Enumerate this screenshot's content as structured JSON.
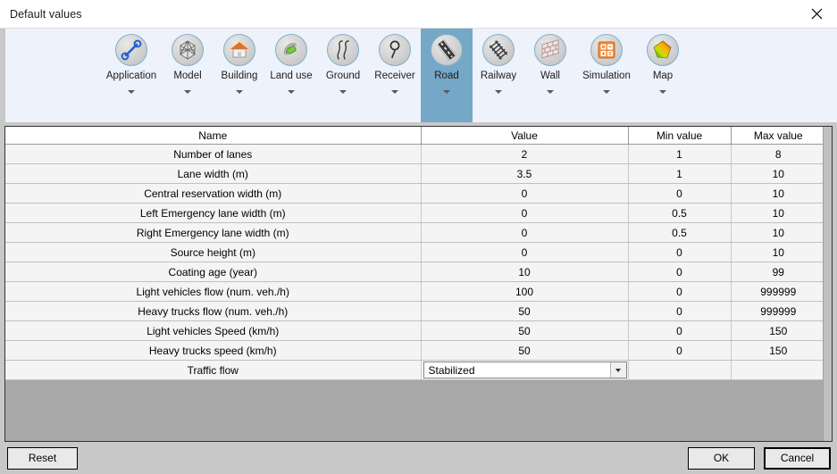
{
  "window": {
    "title": "Default values",
    "close_icon": "close-icon"
  },
  "ribbon": {
    "tabs": [
      {
        "label": "Application",
        "icon": "wrench-icon",
        "selected": false,
        "has_caret": true
      },
      {
        "label": "Model",
        "icon": "mesh-sphere-icon",
        "selected": false,
        "has_caret": true
      },
      {
        "label": "Building",
        "icon": "house-icon",
        "selected": false,
        "has_caret": true
      },
      {
        "label": "Land use",
        "icon": "land-use-icon",
        "selected": false,
        "has_caret": true
      },
      {
        "label": "Ground",
        "icon": "ground-contour-icon",
        "selected": false,
        "has_caret": true
      },
      {
        "label": "Receiver",
        "icon": "receiver-microphone-icon",
        "selected": false,
        "has_caret": true
      },
      {
        "label": "Road",
        "icon": "road-icon",
        "selected": true,
        "has_caret": true
      },
      {
        "label": "Railway",
        "icon": "railway-track-icon",
        "selected": false,
        "has_caret": true
      },
      {
        "label": "Wall",
        "icon": "brick-wall-icon",
        "selected": false,
        "has_caret": true
      },
      {
        "label": "Simulation",
        "icon": "calculator-icon",
        "selected": false,
        "has_caret": true
      },
      {
        "label": "Map",
        "icon": "color-map-icon",
        "selected": false,
        "has_caret": true
      }
    ]
  },
  "table": {
    "columns": [
      "Name",
      "Value",
      "Min value",
      "Max value"
    ],
    "rows": [
      {
        "name": "Number of lanes",
        "value": "2",
        "min": "1",
        "max": "8",
        "type": "text"
      },
      {
        "name": "Lane width (m)",
        "value": "3.5",
        "min": "1",
        "max": "10",
        "type": "text"
      },
      {
        "name": "Central reservation width (m)",
        "value": "0",
        "min": "0",
        "max": "10",
        "type": "text"
      },
      {
        "name": "Left Emergency lane width (m)",
        "value": "0",
        "min": "0.5",
        "max": "10",
        "type": "text"
      },
      {
        "name": "Right Emergency lane width (m)",
        "value": "0",
        "min": "0.5",
        "max": "10",
        "type": "text"
      },
      {
        "name": "Source height (m)",
        "value": "0",
        "min": "0",
        "max": "10",
        "type": "text"
      },
      {
        "name": "Coating age (year)",
        "value": "10",
        "min": "0",
        "max": "99",
        "type": "text"
      },
      {
        "name": "Light vehicles flow (num. veh./h)",
        "value": "100",
        "min": "0",
        "max": "999999",
        "type": "text"
      },
      {
        "name": "Heavy trucks flow (num. veh./h)",
        "value": "50",
        "min": "0",
        "max": "999999",
        "type": "text"
      },
      {
        "name": "Light vehicles Speed (km/h)",
        "value": "50",
        "min": "0",
        "max": "150",
        "type": "text"
      },
      {
        "name": "Heavy trucks speed (km/h)",
        "value": "50",
        "min": "0",
        "max": "150",
        "type": "text"
      },
      {
        "name": "Traffic flow",
        "value": "Stabilized",
        "min": "",
        "max": "",
        "type": "select"
      }
    ]
  },
  "footer": {
    "reset_label": "Reset",
    "ok_label": "OK",
    "cancel_label": "Cancel"
  },
  "colors": {
    "selected_tab": "#75a7c6",
    "name_text": "#1b8a1b",
    "ribbon_bg": "#eef2fb",
    "empty_area": "#a8a8a8"
  }
}
